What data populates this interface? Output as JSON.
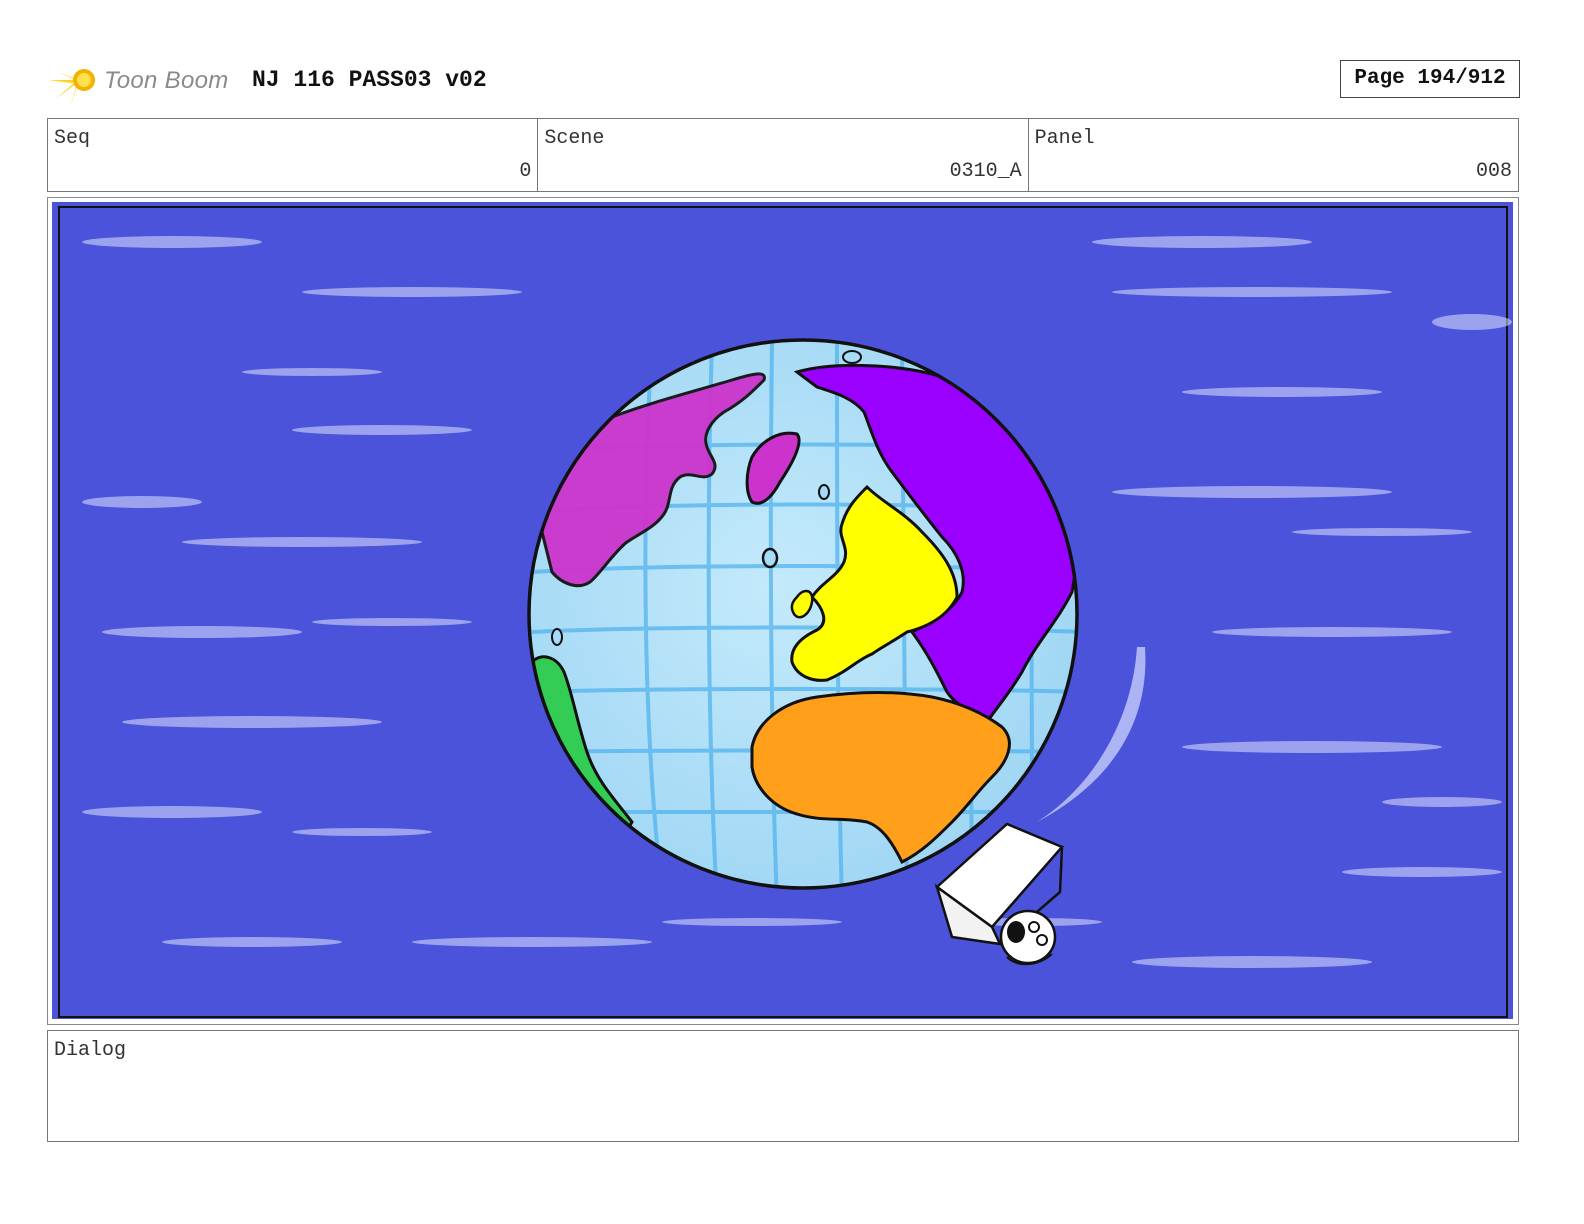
{
  "header": {
    "logo_text": "Toon Boom",
    "title": "NJ 116 PASS03 v02",
    "page_label": "Page 194/912"
  },
  "info": {
    "seq": {
      "label": "Seq",
      "value": "0"
    },
    "scene": {
      "label": "Scene",
      "value": "0310_A"
    },
    "panel": {
      "label": "Panel",
      "value": "008"
    }
  },
  "artwork": {
    "background_color": "#4a53d9",
    "globe_ocean_color": "#a6dcf7",
    "grid_color": "#52b3ee",
    "north_america_color": "#cc33cc",
    "asia_color": "#9900ff",
    "europe_color": "#ffff00",
    "africa_color": "#ff9f1a",
    "south_america_color": "#33cc55"
  },
  "dialog": {
    "label": "Dialog",
    "text": ""
  }
}
